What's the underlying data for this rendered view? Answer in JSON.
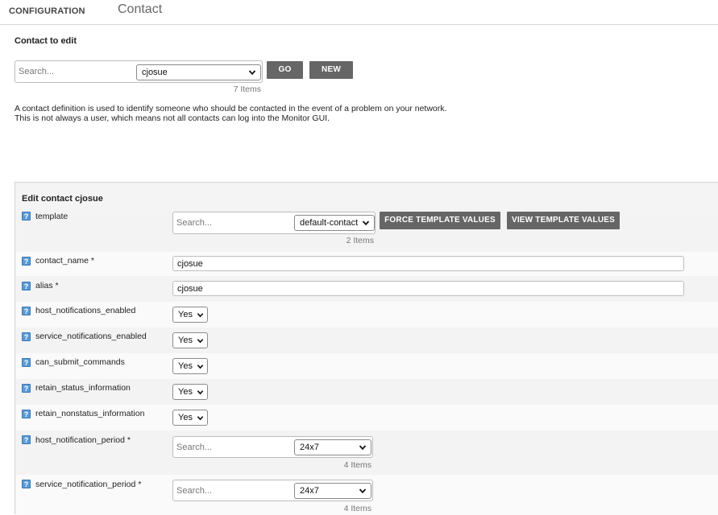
{
  "header": {
    "section": "CONFIGURATION",
    "page_title": "Contact"
  },
  "contact_picker": {
    "title": "Contact to edit",
    "search_placeholder": "Search...",
    "selected": "cjosue",
    "go_label": "GO",
    "new_label": "NEW",
    "items_count": "7 Items"
  },
  "description": "A contact definition is used to identify someone who should be contacted in the event of a problem on your network. This is not always a user, which means not all contacts can log into the Monitor GUI.",
  "edit_panel": {
    "title": "Edit contact cjosue",
    "template": {
      "label": "template",
      "search_placeholder": "Search...",
      "selected": "default-contact",
      "items_count": "2 Items",
      "force_label": "FORCE TEMPLATE VALUES",
      "view_label": "VIEW TEMPLATE VALUES"
    },
    "contact_name": {
      "label": "contact_name *",
      "value": "cjosue"
    },
    "alias": {
      "label": "alias *",
      "value": "cjosue"
    },
    "host_notifications_enabled": {
      "label": "host_notifications_enabled",
      "value": "Yes"
    },
    "service_notifications_enabled": {
      "label": "service_notifications_enabled",
      "value": "Yes"
    },
    "can_submit_commands": {
      "label": "can_submit_commands",
      "value": "Yes"
    },
    "retain_status_information": {
      "label": "retain_status_information",
      "value": "Yes"
    },
    "retain_nonstatus_information": {
      "label": "retain_nonstatus_information",
      "value": "Yes"
    },
    "host_notification_period": {
      "label": "host_notification_period *",
      "search_placeholder": "Search...",
      "selected": "24x7",
      "items_count": "4 Items"
    },
    "service_notification_period": {
      "label": "service_notification_period *",
      "search_placeholder": "Search...",
      "selected": "24x7",
      "items_count": "4 Items"
    },
    "help_glyph": "?"
  },
  "colors": {
    "button_bg": "#666666",
    "help_icon": "#5b9bd5"
  }
}
